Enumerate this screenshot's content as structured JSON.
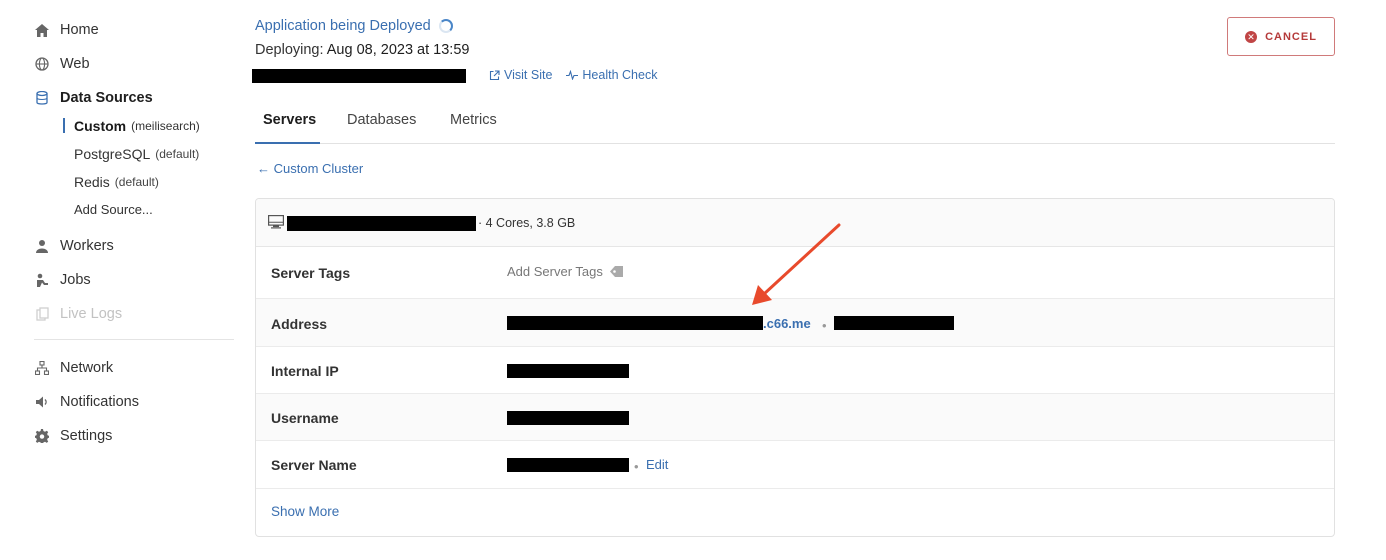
{
  "sidebar": {
    "items": [
      {
        "label": "Home",
        "icon": "home-icon"
      },
      {
        "label": "Web",
        "icon": "globe-icon"
      },
      {
        "label": "Data Sources",
        "icon": "database-icon"
      },
      {
        "label": "Workers",
        "icon": "workers-icon"
      },
      {
        "label": "Jobs",
        "icon": "jobs-icon"
      },
      {
        "label": "Live Logs",
        "icon": "copy-icon"
      },
      {
        "label": "Network",
        "icon": "network-icon"
      },
      {
        "label": "Notifications",
        "icon": "speaker-icon"
      },
      {
        "label": "Settings",
        "icon": "gear-icon"
      }
    ],
    "data_sources": [
      {
        "label": "Custom",
        "tag": "(meilisearch)"
      },
      {
        "label": "PostgreSQL",
        "tag": "(default)"
      },
      {
        "label": "Redis",
        "tag": "(default)"
      },
      {
        "label": "Add Source...",
        "tag": ""
      }
    ]
  },
  "header": {
    "status": "Application being Deployed",
    "deploying_label": "Deploying:",
    "deploying_time": "Aug 08, 2023 at 13:59",
    "visit_site": "Visit Site",
    "health_check": "Health Check",
    "cancel": "CANCEL"
  },
  "tabs": [
    "Servers",
    "Databases",
    "Metrics"
  ],
  "back_link": "← Custom Cluster",
  "server": {
    "specs": "· 4 Cores, 3.8 GB",
    "rows": {
      "tags_label": "Server Tags",
      "tags_value": "Add Server Tags",
      "address_label": "Address",
      "address_suffix": ".c66.me",
      "internal_ip_label": "Internal IP",
      "username_label": "Username",
      "server_name_label": "Server Name",
      "edit": "Edit"
    },
    "show_more": "Show More"
  },
  "colors": {
    "accent": "#3a6fb0",
    "cancel": "#b53a3a",
    "annotation_arrow": "#e84a2c"
  }
}
